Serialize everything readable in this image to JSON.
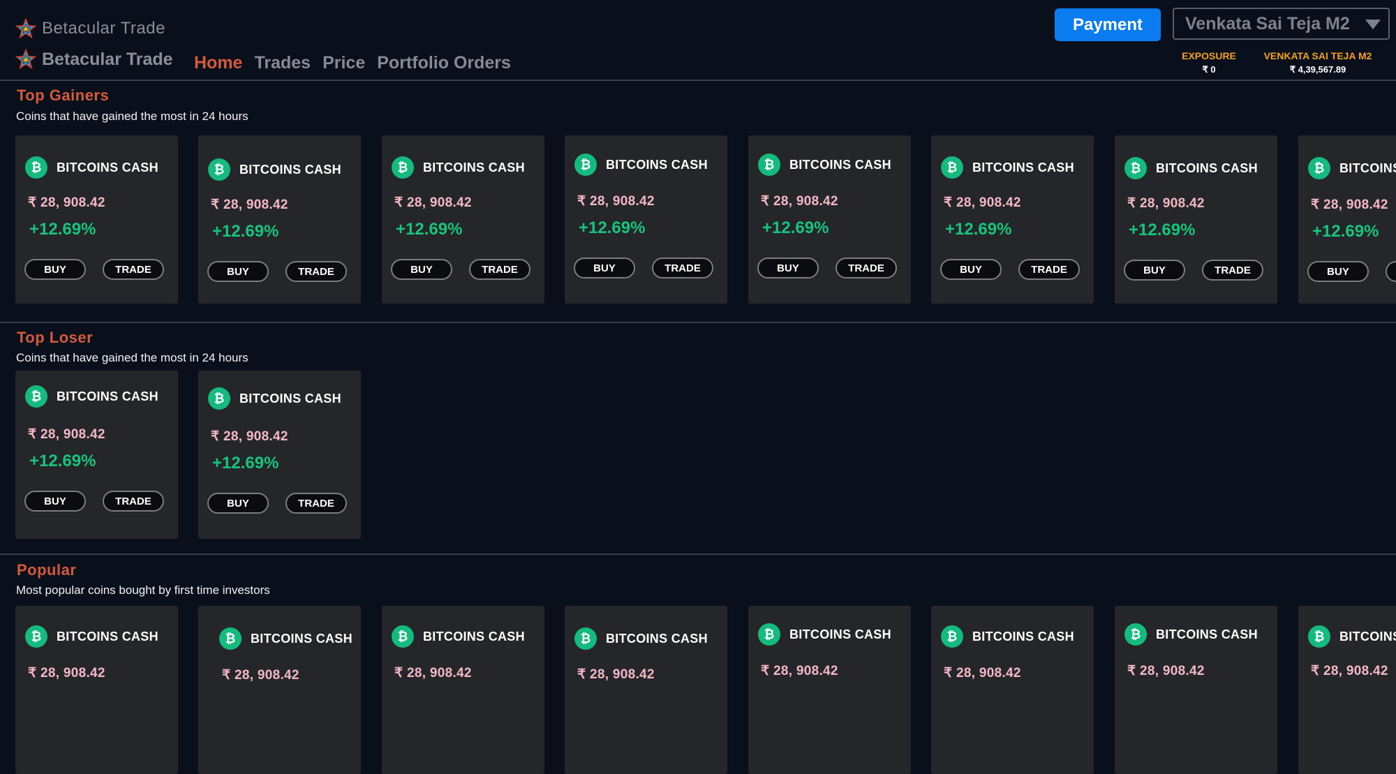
{
  "brand": {
    "top_name": "Betacular Trade",
    "name": "Betacular Trade"
  },
  "nav": [
    "Home",
    "Trades",
    "Price",
    "Portfolio Orders"
  ],
  "header": {
    "payment_label": "Payment",
    "user_name": "Venkata Sai Teja M2",
    "exposure_label": "EXPOSURE",
    "exposure_value": "₹ 0",
    "account_label": "VENKATA SAI TEJA M2",
    "account_value": "₹ 4,39,567.89"
  },
  "sections": [
    {
      "title": "Top Gainers",
      "subtitle": "Coins that have gained the most in 24 hours"
    },
    {
      "title": "Top Loser",
      "subtitle": "Coins that have gained the most in 24 hours"
    },
    {
      "title": "Popular",
      "subtitle": "Most popular coins bought by first time investors"
    }
  ],
  "coin": {
    "icon_glyph": "₿",
    "name": "BITCOINS CASH",
    "price": "₹ 28, 908.42",
    "change": "+12.69%",
    "buy_label": "BUY",
    "trade_label": "TRADE"
  },
  "colors": {
    "background": "#0a101b",
    "accent": "#d45a3c",
    "payment": "#0a7cf0",
    "positive": "#17c47c",
    "price": "#f4b8c4",
    "stat_label": "#f3a11c",
    "coin_icon": "#15ba7e"
  },
  "icons": {
    "logo": "star-logo-icon",
    "coin": "bitcoin-cash-icon",
    "caret": "caret-down-icon"
  }
}
